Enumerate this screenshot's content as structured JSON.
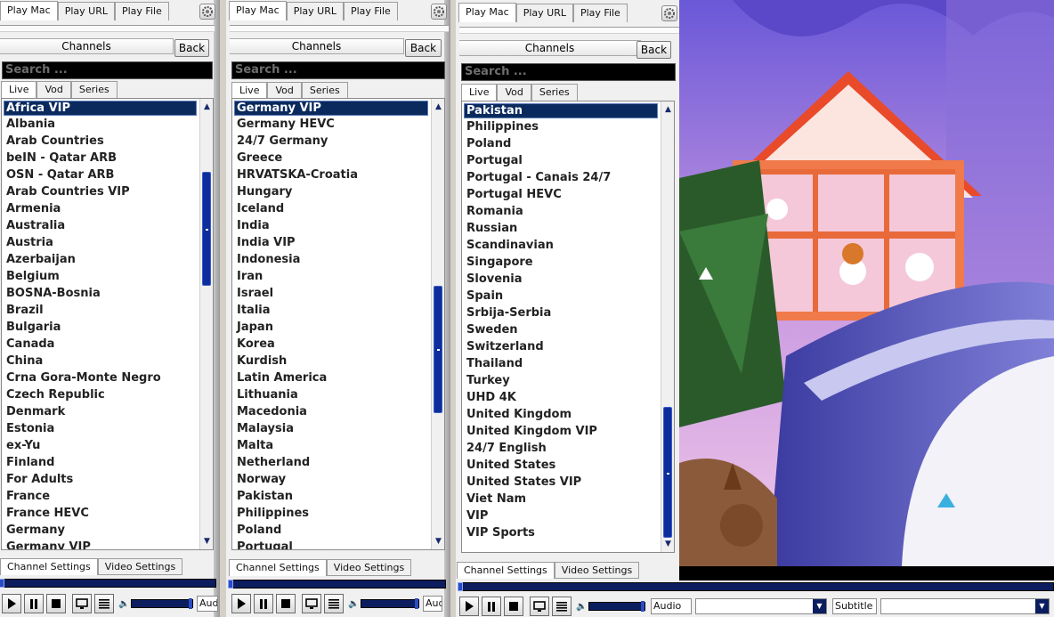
{
  "panels": [
    {
      "tabs": [
        "Play Mac",
        "Play URL",
        "Play File"
      ],
      "channels_label": "Channels",
      "back_label": "Back",
      "search_placeholder": "Search ...",
      "subtabs": [
        "Live",
        "Vod",
        "Series"
      ],
      "items": [
        "Africa VIP",
        "Albania",
        "Arab Countries",
        "beIN - Qatar ARB",
        "OSN - Qatar ARB",
        "Arab Countries VIP",
        "Armenia",
        "Australia",
        "Austria",
        "Azerbaijan",
        "Belgium",
        "BOSNA-Bosnia",
        "Brazil",
        "Bulgaria",
        "Canada",
        "China",
        "Crna Gora-Monte Negro",
        "Czech Republic",
        "Denmark",
        "Estonia",
        "ex-Yu",
        "Finland",
        "For Adults",
        "France",
        "France HEVC",
        "Germany",
        "Germany VIP"
      ],
      "selected_index": 0,
      "bottom_tabs": [
        "Channel Settings",
        "Video Settings"
      ],
      "audio_label": "Audio"
    },
    {
      "tabs": [
        "Play Mac",
        "Play URL",
        "Play File"
      ],
      "channels_label": "Channels",
      "back_label": "Back",
      "search_placeholder": "Search ...",
      "subtabs": [
        "Live",
        "Vod",
        "Series"
      ],
      "items": [
        "Germany VIP",
        "Germany HEVC",
        "24/7 Germany",
        "Greece",
        "HRVATSKA-Croatia",
        "Hungary",
        "Iceland",
        "India",
        "India VIP",
        "Indonesia",
        "Iran",
        "Israel",
        "Italia",
        "Japan",
        "Korea",
        "Kurdish",
        "Latin America",
        "Lithuania",
        "Macedonia",
        "Malaysia",
        "Malta",
        "Netherland",
        "Norway",
        "Pakistan",
        "Philippines",
        "Poland",
        "Portugal"
      ],
      "selected_index": 0,
      "bottom_tabs": [
        "Channel Settings",
        "Video Settings"
      ],
      "audio_label": "Audio"
    },
    {
      "tabs": [
        "Play Mac",
        "Play URL",
        "Play File"
      ],
      "channels_label": "Channels",
      "back_label": "Back",
      "search_placeholder": "Search ...",
      "subtabs": [
        "Live",
        "Vod",
        "Series"
      ],
      "items": [
        "Pakistan",
        "Philippines",
        "Poland",
        "Portugal",
        "Portugal - Canais 24/7",
        "Portugal HEVC",
        "Romania",
        "Russian",
        "Scandinavian",
        "Singapore",
        "Slovenia",
        "Spain",
        "Srbija-Serbia",
        "Sweden",
        "Switzerland",
        "Thailand",
        "Turkey",
        "UHD 4K",
        "United Kingdom",
        "United Kingdom VIP",
        "24/7 English",
        "United States",
        "United States VIP",
        "Viet Nam",
        "VIP",
        "VIP Sports"
      ],
      "selected_index": 0,
      "bottom_tabs": [
        "Channel Settings",
        "Video Settings"
      ],
      "audio_label": "Audio",
      "subtitle_label": "Subtitle"
    }
  ],
  "scrollbars": [
    {
      "thumb_start": 0.14,
      "thumb_end": 0.41
    },
    {
      "thumb_start": 0.41,
      "thumb_end": 0.71
    },
    {
      "thumb_start": 0.69,
      "thumb_end": 1.0
    }
  ],
  "colors": {
    "selection": "#0a2a5e",
    "accent": "#0c2d9a",
    "search_bg": "#000000"
  },
  "icons": [
    "gear-icon",
    "play-icon",
    "pause-icon",
    "stop-icon",
    "monitor-icon",
    "playlist-icon",
    "speaker-icon",
    "chevron-down-icon",
    "scroll-up-icon",
    "scroll-down-icon"
  ]
}
